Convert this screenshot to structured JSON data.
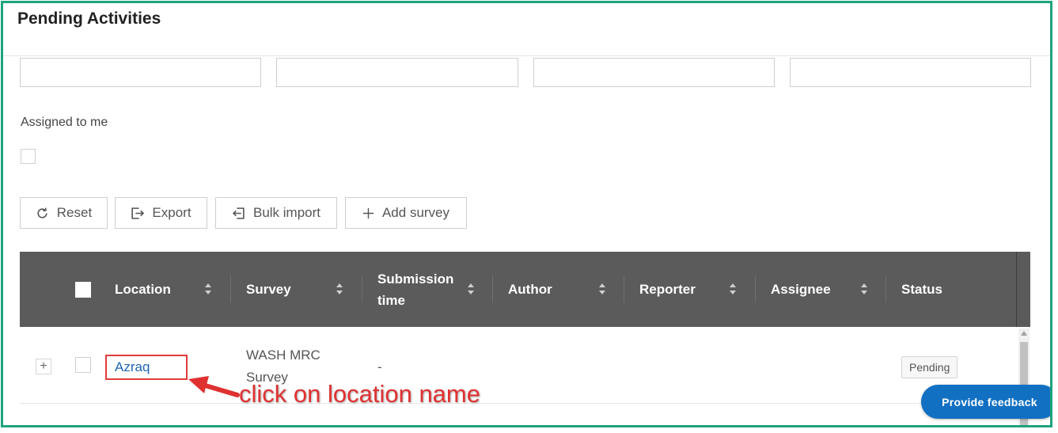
{
  "page": {
    "title": "Pending Activities"
  },
  "filters": {
    "inputs": [
      "",
      "",
      "",
      ""
    ],
    "assigned_to_me_label": "Assigned to me",
    "assigned_to_me_checked": false
  },
  "toolbar": {
    "reset_label": "Reset",
    "export_label": "Export",
    "bulk_import_label": "Bulk import",
    "add_survey_label": "Add survey"
  },
  "table": {
    "columns": [
      "Location",
      "Survey",
      "Submission time",
      "Author",
      "Reporter",
      "Assignee",
      "Status"
    ],
    "rows": [
      {
        "location": "Azraq",
        "survey": "WASH MRC Survey",
        "submission_time": "-",
        "author": "",
        "reporter": "",
        "assignee": "",
        "status": "Pending"
      }
    ]
  },
  "annotation": {
    "text": "click on location name",
    "color": "#e03131"
  },
  "feedback_button": {
    "label": "Provide feedback"
  },
  "colors": {
    "frame": "#1ea37e",
    "header_bg": "#5b5b5b",
    "link": "#1f66b2",
    "feedback_bg": "#1170c2"
  }
}
